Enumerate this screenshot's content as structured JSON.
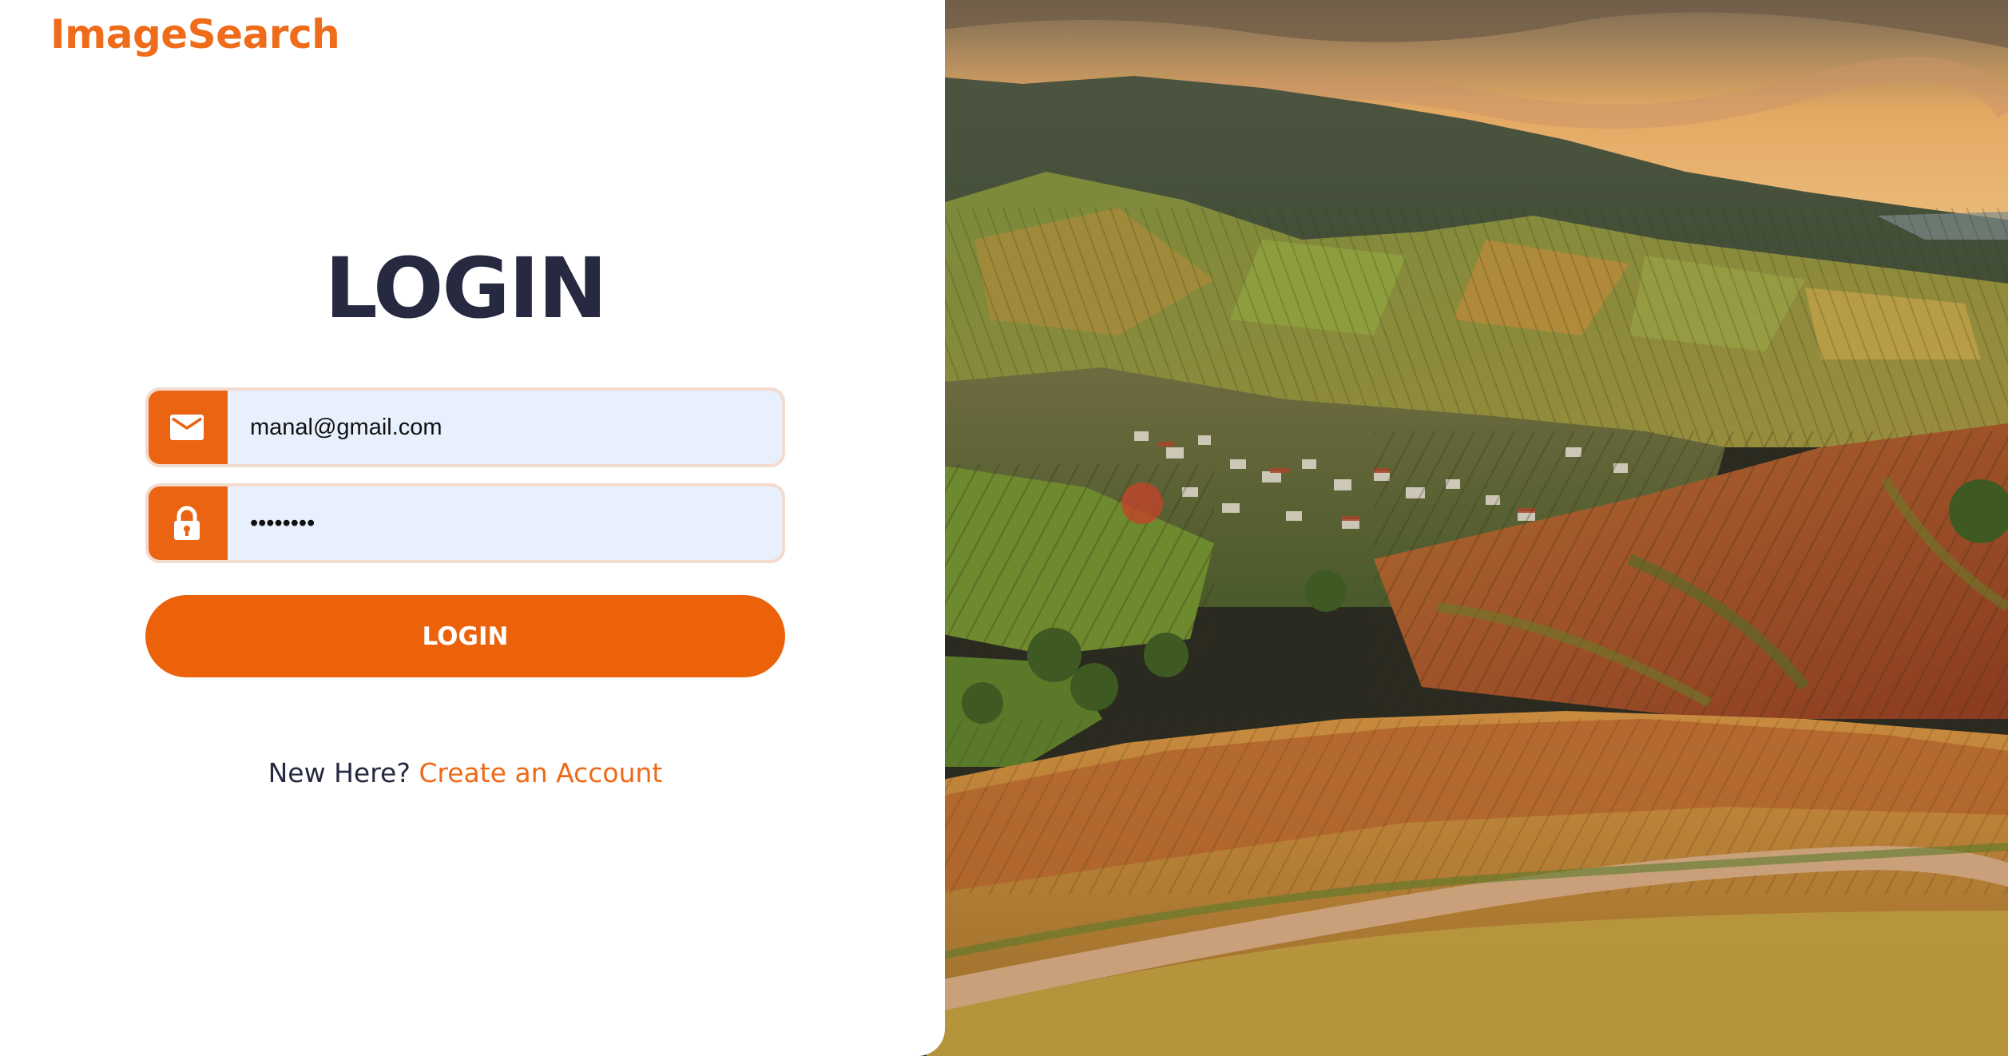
{
  "brand": {
    "name": "ImageSearch"
  },
  "login_form": {
    "title": "LOGIN",
    "email": {
      "value": "manal@gmail.com",
      "icon": "mail-icon"
    },
    "password": {
      "value": "manal123",
      "icon": "lock-icon"
    },
    "submit_label": "LOGIN"
  },
  "signup_prompt": {
    "text": "New Here?",
    "link_label": "Create an Account"
  },
  "hero_image": {
    "subject": "vineyard-landscape"
  },
  "colors": {
    "accent": "#eb620b",
    "heading": "#262940",
    "input_bg": "#e8effd",
    "input_border": "#f3dccd"
  }
}
